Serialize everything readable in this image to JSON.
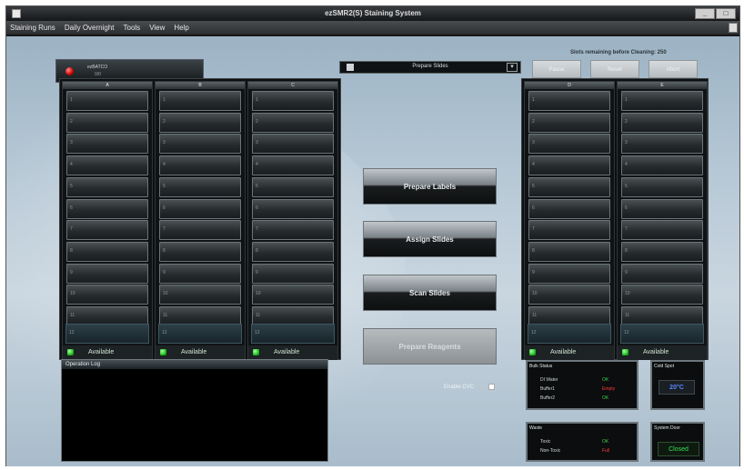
{
  "window": {
    "title": "ezSMR2(S) Staining System",
    "controls": [
      "_",
      "□"
    ]
  },
  "menu": {
    "items": [
      "Staining Runs",
      "Daily Overnight",
      "Tools",
      "View",
      "Help"
    ]
  },
  "bath_status": {
    "name": "ezBATCO",
    "sub": "0/0"
  },
  "left_columns": [
    {
      "head": "A",
      "slots": [
        "1",
        "2",
        "3",
        "4",
        "5",
        "6",
        "7",
        "8",
        "9",
        "10",
        "11"
      ],
      "bottom": "12",
      "status": "Available"
    },
    {
      "head": "B",
      "slots": [
        "1",
        "2",
        "3",
        "4",
        "5",
        "6",
        "7",
        "8",
        "9",
        "10",
        "11"
      ],
      "bottom": "12",
      "status": "Available"
    },
    {
      "head": "C",
      "slots": [
        "1",
        "2",
        "3",
        "4",
        "5",
        "6",
        "7",
        "8",
        "9",
        "10",
        "11"
      ],
      "bottom": "12",
      "status": "Available"
    }
  ],
  "right_columns": [
    {
      "head": "D",
      "slots": [
        "1",
        "2",
        "3",
        "4",
        "5",
        "6",
        "7",
        "8",
        "9",
        "10",
        "11"
      ],
      "bottom": "12",
      "status": "Available"
    },
    {
      "head": "E",
      "slots": [
        "1",
        "2",
        "3",
        "4",
        "5",
        "6",
        "7",
        "8",
        "9",
        "10",
        "11"
      ],
      "bottom": "12",
      "status": "Available"
    }
  ],
  "center": {
    "dropdown_value": "Prepare Slides",
    "actions": [
      "Prepare Labels",
      "Assign Slides",
      "Scan Slides",
      "Prepare Reagents"
    ],
    "enable_label": "Enable CVC"
  },
  "top_right": {
    "label": "Slots remaining before Cleaning: 250",
    "buttons": [
      "Pause",
      "Reset",
      "Abort"
    ]
  },
  "operation_log": {
    "title": "Operation Log"
  },
  "bulk_status": {
    "title": "Bulk Status",
    "rows": [
      {
        "label": "DI Water",
        "value": "OK",
        "color": "#3ad14f"
      },
      {
        "label": "Buffer1",
        "value": "Empty",
        "color": "#ff3b3b"
      },
      {
        "label": "Buffer2",
        "value": "OK",
        "color": "#3ad14f"
      }
    ]
  },
  "cold_spot": {
    "title": "Cold Spot",
    "value": "20°C"
  },
  "waste": {
    "title": "Waste",
    "rows": [
      {
        "label": "Toxic",
        "value": "OK",
        "color": "#3ad14f"
      },
      {
        "label": "Non-Toxic",
        "value": "Full",
        "color": "#ff3b3b"
      }
    ]
  },
  "system_door": {
    "title": "System Door",
    "value": "Closed"
  }
}
